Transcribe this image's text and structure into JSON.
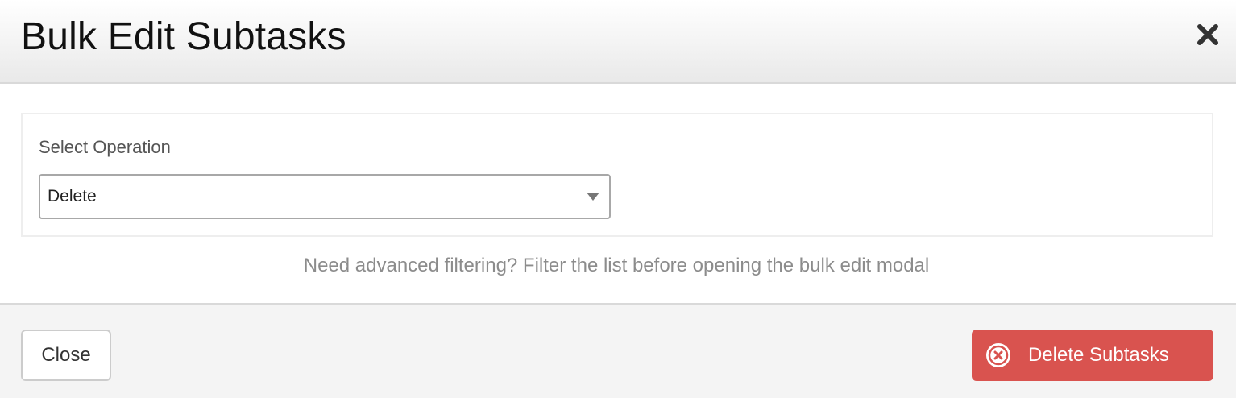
{
  "modal": {
    "title": "Bulk Edit Subtasks",
    "close_icon": "close-x-icon"
  },
  "form": {
    "operation_label": "Select Operation",
    "operation_selected": "Delete",
    "dropdown_icon": "caret-down-icon"
  },
  "hint": "Need advanced filtering? Filter the list before opening the bulk edit modal",
  "footer": {
    "close_label": "Close",
    "delete_label": "Delete Subtasks",
    "delete_icon": "circle-x-icon"
  },
  "colors": {
    "danger": "#d9534f",
    "header_gradient_end": "#e9e9e9",
    "footer_bg": "#f4f4f4"
  }
}
